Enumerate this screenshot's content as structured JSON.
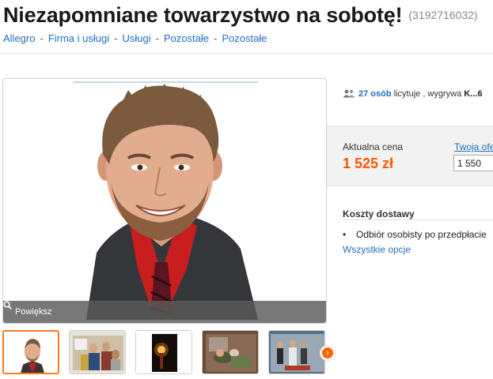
{
  "header": {
    "title": "Niezapomniane towarzystwo na sobotę!",
    "offer_id": "(3192716032)"
  },
  "breadcrumb": {
    "items": [
      "Allegro",
      "Firma i usługi",
      "Usługi",
      "Pozostałe",
      "Pozostałe"
    ],
    "separator": "-"
  },
  "gallery": {
    "zoom_label": "Powiększ",
    "thumbnails_count": 5,
    "next_icon": "chevron-right-icon"
  },
  "auction": {
    "bidders_count": "27 osób",
    "bidders_text": "licytuje , wygrywa",
    "winner": "K...6",
    "current_price_label": "Aktualna cena",
    "current_price": "1 525 zł",
    "your_offer_label": "Twoja oferta",
    "your_offer_value": "1 550"
  },
  "shipping": {
    "title": "Koszty dostawy",
    "items": [
      "Odbiór osobisty po przedpłacie"
    ],
    "all_options_label": "Wszystkie opcje"
  },
  "colors": {
    "accent": "#ff5a00",
    "link": "#1f6fbf",
    "thumb_active_border": "#ff7a1a"
  }
}
